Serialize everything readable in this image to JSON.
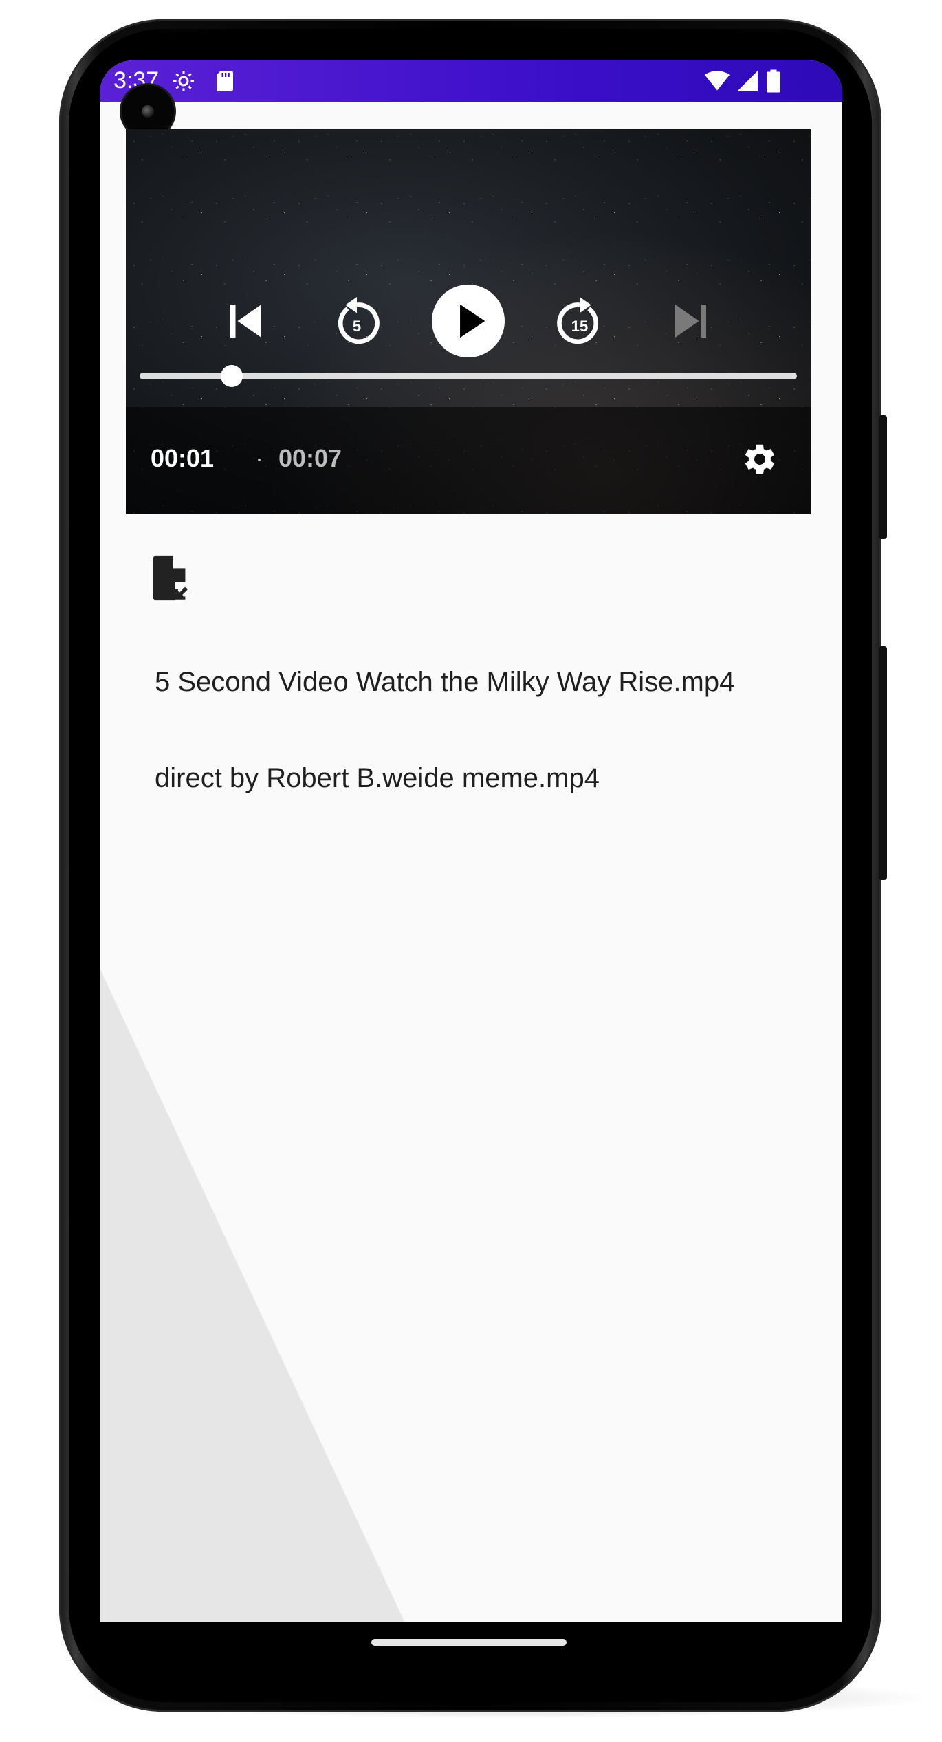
{
  "status_bar": {
    "time": "3:37",
    "icons_left": [
      "settings-gear-icon",
      "sd-card-icon"
    ],
    "icons_right": [
      "wifi-icon",
      "cell-signal-icon",
      "battery-icon"
    ],
    "color": "#3c0fc9"
  },
  "player": {
    "controls": [
      "previous-icon",
      "rewind-5-icon",
      "play-icon",
      "forward-15-icon",
      "next-icon"
    ],
    "rewind_label": "5",
    "forward_label": "15",
    "current_time": "00:01",
    "separator": "·",
    "duration": "00:07",
    "progress": 0.14
  },
  "content": {
    "open_file_icon": "file-open-icon",
    "files": [
      "5 Second Video Watch the Milky Way Rise.mp4",
      "direct by Robert B.weide meme.mp4"
    ]
  }
}
